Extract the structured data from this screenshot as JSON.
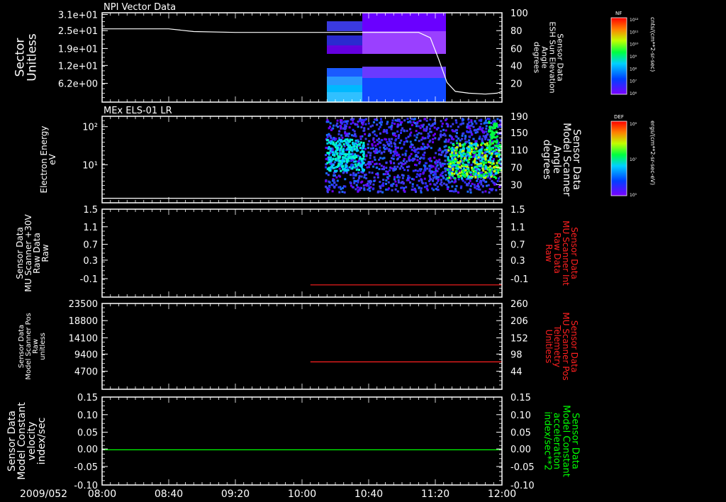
{
  "time_axis": {
    "date_label": "2009/052",
    "ticks": [
      "08:00",
      "08:40",
      "09:20",
      "10:00",
      "10:40",
      "11:20",
      "12:00"
    ],
    "range": [
      "08:00",
      "12:00"
    ]
  },
  "colors": {
    "background": "#000000",
    "axis": "#ffffff",
    "red_trace": "#ff2020",
    "green_trace": "#00ff00"
  },
  "chart_data": [
    {
      "id": "panel1",
      "type": "heatmap",
      "title": "NPI Vector Data",
      "ylabel_left": [
        "Sector",
        "Unitless"
      ],
      "ylabel_right": [
        "Sensor Data",
        "ESH Sun Elevation",
        "Angle",
        "degrees"
      ],
      "yticks_left": [
        "3.1e+01",
        "2.5e+01",
        "1.9e+01",
        "1.2e+01",
        "6.2e+00"
      ],
      "yticks_right": [
        "100",
        "80",
        "60",
        "40",
        "20"
      ],
      "ylim_right": [
        0,
        100
      ],
      "colorbar": {
        "title": "NF",
        "ticks": [
          "10^12",
          "10^11",
          "10^10",
          "10^9",
          "10^8",
          "10^7",
          "10^6"
        ],
        "units": "cnts/(cm**2-sr-sec)"
      },
      "overlay_line": {
        "name": "ESH Sun Elevation Angle",
        "x": [
          "08:00",
          "08:40",
          "08:55",
          "09:20",
          "10:00",
          "10:40",
          "11:10",
          "11:17",
          "11:22",
          "11:27",
          "11:32",
          "11:40",
          "11:50",
          "11:57",
          "12:00"
        ],
        "y": [
          82,
          82,
          79,
          78,
          78,
          78,
          78,
          72,
          48,
          22,
          12,
          10,
          9,
          10,
          12
        ]
      }
    },
    {
      "id": "panel2",
      "type": "heatmap",
      "title": "MEx ELS-01 LR",
      "ylabel_left": [
        "Electron Energy",
        "eV"
      ],
      "ylabel_right": [
        "Sensor Data",
        "Model Scanner",
        "Angle",
        "degrees"
      ],
      "yticks_left": [
        "10^2",
        "10^1"
      ],
      "yticks_right": [
        "190",
        "150",
        "110",
        "70",
        "30"
      ],
      "ylim_right": [
        0,
        190
      ],
      "colorbar": {
        "title": "DEF",
        "ticks": [
          "10^9",
          "10^7",
          "10^5"
        ],
        "units": "ergs/(cm**2-sr-sec-eV)"
      },
      "overlay_line": {
        "name": "Model Scanner Angle",
        "x": [
          "08:00",
          "12:00"
        ],
        "y": [
          10,
          10
        ]
      }
    },
    {
      "id": "panel3",
      "type": "line",
      "ylabel_left": [
        "Sensor Data",
        "MU Scanner +30V",
        "Raw Data",
        "Raw"
      ],
      "ylabel_right": [
        "Sensor Data",
        "MU Scanner Int",
        "Raw Data",
        "Raw"
      ],
      "yticks_left": [
        "1.5",
        "1.1",
        "0.7",
        "0.3",
        "-0.1"
      ],
      "yticks_right": [
        "1.5",
        "1.1",
        "0.7",
        "0.3",
        "-0.1"
      ],
      "ylim": [
        -0.3,
        1.5
      ],
      "series": [
        {
          "name": "MU Scanner Int",
          "color": "#ff2020",
          "x": [
            "10:05",
            "12:00"
          ],
          "y": [
            -0.05,
            -0.05
          ]
        }
      ]
    },
    {
      "id": "panel4",
      "type": "line",
      "ylabel_left": [
        "Sensor Data",
        "Model Scanner Pos",
        "Raw",
        "unitless"
      ],
      "ylabel_right": [
        "Sensor Data",
        "MU Scanner Pos",
        "Telemetry",
        "Unitless"
      ],
      "yticks_left": [
        "23500",
        "18800",
        "14100",
        "9400",
        "4700"
      ],
      "yticks_right": [
        "260",
        "206",
        "152",
        "98",
        "44"
      ],
      "ylim_right": [
        0,
        260
      ],
      "series": [
        {
          "name": "MU Scanner Pos",
          "color": "#ff2020",
          "x": [
            "10:05",
            "12:00"
          ],
          "y": [
            83,
            83
          ]
        }
      ]
    },
    {
      "id": "panel5",
      "type": "line",
      "ylabel_left": [
        "Sensor Data",
        "Model Constant",
        "velocity",
        "index/sec"
      ],
      "ylabel_right": [
        "Sensor Data",
        "Model Constant",
        "acceleration",
        "index/sec**2"
      ],
      "yticks_left": [
        "0.15",
        "0.10",
        "0.05",
        "0.00",
        "-0.05",
        "-0.10"
      ],
      "yticks_right": [
        "0.15",
        "0.10",
        "0.05",
        "0.00",
        "-0.05",
        "-0.10"
      ],
      "ylim": [
        -0.1,
        0.15
      ],
      "series": [
        {
          "name": "Model Constant acceleration",
          "color": "#00ff00",
          "x": [
            "08:00",
            "12:00"
          ],
          "y": [
            0.0,
            0.0
          ]
        }
      ]
    }
  ]
}
